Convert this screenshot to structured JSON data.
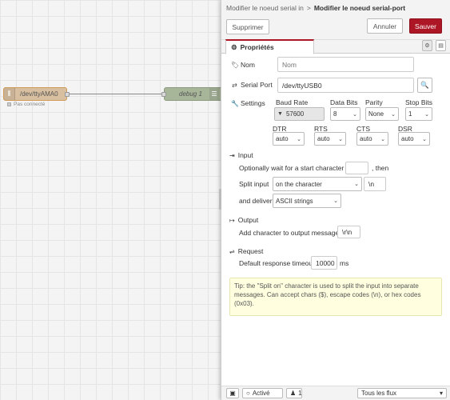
{
  "workspace": {
    "serial_node": {
      "label": "/dev/ttyAMA0",
      "status": "Pas connecté",
      "icon": "serial-port-icon"
    },
    "debug_node": {
      "label": "debug 1",
      "icon": "list-lines-icon"
    }
  },
  "tray": {
    "breadcrumb": {
      "parent": "Modifier le noeud serial in",
      "separator": ">",
      "current": "Modifier le noeud serial-port"
    },
    "delete_label": "Supprimer",
    "cancel_label": "Annuler",
    "save_label": "Sauver",
    "tab_label": "Propriétés",
    "accent_color": "#ad1625"
  },
  "form": {
    "name": {
      "label": "Nom",
      "placeholder": "Nom",
      "icon": "tag-icon"
    },
    "serial_port": {
      "label": "Serial Port",
      "value": "/dev/ttyUSB0",
      "icon": "shuffle-icon",
      "search_icon": "search-icon"
    },
    "settings": {
      "label": "Settings",
      "icon": "wrench-icon",
      "baud_rate": {
        "label": "Baud Rate",
        "value": "57600"
      },
      "data_bits": {
        "label": "Data Bits",
        "value": "8"
      },
      "parity": {
        "label": "Parity",
        "value": "None"
      },
      "stop_bits": {
        "label": "Stop Bits",
        "value": "1"
      },
      "dtr": {
        "label": "DTR",
        "value": "auto"
      },
      "rts": {
        "label": "RTS",
        "value": "auto"
      },
      "cts": {
        "label": "CTS",
        "value": "auto"
      },
      "dsr": {
        "label": "DSR",
        "value": "auto"
      }
    },
    "input": {
      "heading": "Input",
      "icon": "sign-in-icon",
      "wait_prefix": "Optionally wait for a start character of",
      "wait_value": "",
      "wait_suffix": ", then",
      "split_label": "Split input",
      "split_mode": "on the character",
      "split_char": "\\n",
      "deliver_label": "and deliver",
      "deliver_value": "ASCII strings"
    },
    "output": {
      "heading": "Output",
      "icon": "sign-out-icon",
      "add_char_label": "Add character to output messages",
      "add_char_value": "\\r\\n"
    },
    "request": {
      "heading": "Request",
      "icon": "exchange-icon",
      "timeout_label": "Default response timeout",
      "timeout_value": "10000",
      "timeout_unit": "ms"
    },
    "tip": "Tip: the \"Split on\" character is used to split the input into separate messages. Can accept chars ($), escape codes (\\n), or hex codes (0x03)."
  },
  "footer": {
    "active_label": "Activé",
    "users_count": "1",
    "scope_value": "Tous les flux"
  }
}
